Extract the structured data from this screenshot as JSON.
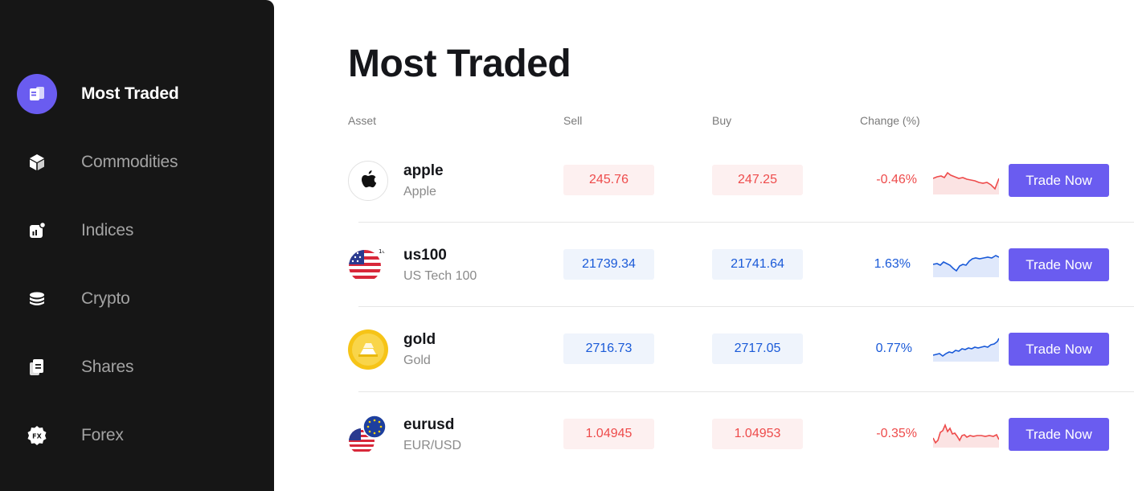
{
  "sidebar": {
    "items": [
      {
        "label": "Most Traded",
        "icon": "most-traded-icon",
        "active": true
      },
      {
        "label": "Commodities",
        "icon": "box-icon",
        "active": false
      },
      {
        "label": "Indices",
        "icon": "indices-chart-icon",
        "active": false
      },
      {
        "label": "Crypto",
        "icon": "coins-stack-icon",
        "active": false
      },
      {
        "label": "Shares",
        "icon": "documents-icon",
        "active": false
      },
      {
        "label": "Forex",
        "icon": "fx-badge-icon",
        "active": false
      }
    ],
    "forex_badge_text": "FX"
  },
  "main": {
    "title": "Most Traded",
    "columns": {
      "asset": "Asset",
      "sell": "Sell",
      "buy": "Buy",
      "change": "Change (%)"
    },
    "rows": [
      {
        "symbol": "apple",
        "name": "Apple",
        "sell": "245.76",
        "buy": "247.25",
        "change": "-0.46%",
        "direction": "down",
        "logo": "apple-logo-icon",
        "trade_label": "Trade Now"
      },
      {
        "symbol": "us100",
        "name": "US Tech 100",
        "sell": "21739.34",
        "buy": "21741.64",
        "change": "1.63%",
        "direction": "up",
        "logo": "us-flag-icon",
        "logo_badge": "100",
        "trade_label": "Trade Now"
      },
      {
        "symbol": "gold",
        "name": "Gold",
        "sell": "2716.73",
        "buy": "2717.05",
        "change": "0.77%",
        "direction": "up",
        "logo": "gold-bars-icon",
        "trade_label": "Trade Now"
      },
      {
        "symbol": "eurusd",
        "name": "EUR/USD",
        "sell": "1.04945",
        "buy": "1.04953",
        "change": "-0.35%",
        "direction": "down",
        "logo": "eu-us-flags-icon",
        "trade_label": "Trade Now"
      }
    ]
  },
  "colors": {
    "sidebar_bg": "#161616",
    "accent": "#6a5cf0",
    "down": "#ee4b4b",
    "up": "#1a5ad8",
    "down_bg": "#fdf0f0",
    "up_bg": "#eff4fc"
  }
}
